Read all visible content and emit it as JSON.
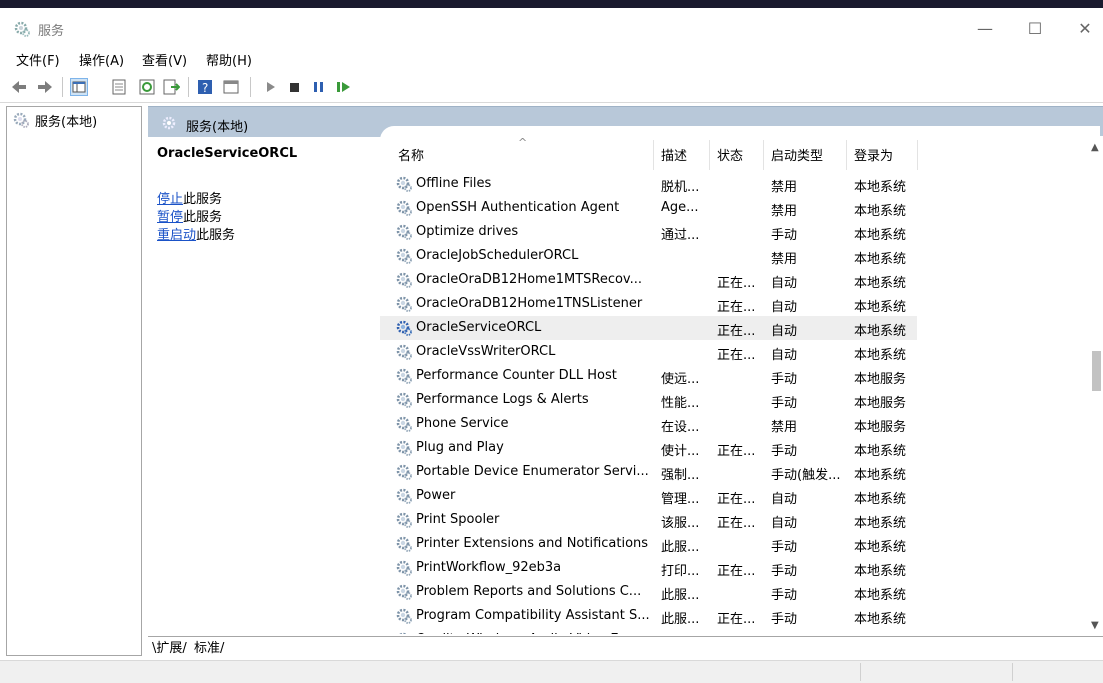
{
  "window": {
    "title": "服务",
    "minimize": "—",
    "maximize": "☐",
    "close": "✕"
  },
  "menu": [
    "文件(F)",
    "操作(A)",
    "查看(V)",
    "帮助(H)"
  ],
  "toolbar_icons": [
    "back-arrow-icon",
    "forward-arrow-icon",
    "console-tree-icon",
    "properties-icon",
    "refresh-icon",
    "export-list-icon",
    "help-icon",
    "view-icon",
    "start-service-icon",
    "stop-service-icon",
    "pause-service-icon",
    "resume-service-icon"
  ],
  "tree": {
    "root_label": "服务(本地)"
  },
  "panel": {
    "header_label": "服务(本地)",
    "selected_service": "OracleServiceORCL",
    "actions": [
      {
        "link": "停止",
        "rest": "此服务"
      },
      {
        "link": "暂停",
        "rest": "此服务"
      },
      {
        "link": "重启动",
        "rest": "此服务"
      }
    ]
  },
  "list": {
    "sort_indicator": "^",
    "columns": [
      "名称",
      "描述",
      "状态",
      "启动类型",
      "登录为"
    ],
    "rows": [
      {
        "name": "Offline Files",
        "desc": "脱机...",
        "status": "",
        "startup": "禁用",
        "logon": "本地系统"
      },
      {
        "name": "OpenSSH Authentication Agent",
        "desc": "Age...",
        "status": "",
        "startup": "禁用",
        "logon": "本地系统"
      },
      {
        "name": "Optimize drives",
        "desc": "通过...",
        "status": "",
        "startup": "手动",
        "logon": "本地系统"
      },
      {
        "name": "OracleJobSchedulerORCL",
        "desc": "",
        "status": "",
        "startup": "禁用",
        "logon": "本地系统"
      },
      {
        "name": "OracleOraDB12Home1MTSRecov...",
        "desc": "",
        "status": "正在...",
        "startup": "自动",
        "logon": "本地系统"
      },
      {
        "name": "OracleOraDB12Home1TNSListener",
        "desc": "",
        "status": "正在...",
        "startup": "自动",
        "logon": "本地系统"
      },
      {
        "name": "OracleServiceORCL",
        "desc": "",
        "status": "正在...",
        "startup": "自动",
        "logon": "本地系统",
        "selected": true
      },
      {
        "name": "OracleVssWriterORCL",
        "desc": "",
        "status": "正在...",
        "startup": "自动",
        "logon": "本地系统"
      },
      {
        "name": "Performance Counter DLL Host",
        "desc": "使远...",
        "status": "",
        "startup": "手动",
        "logon": "本地服务"
      },
      {
        "name": "Performance Logs & Alerts",
        "desc": "性能...",
        "status": "",
        "startup": "手动",
        "logon": "本地服务"
      },
      {
        "name": "Phone Service",
        "desc": "在设...",
        "status": "",
        "startup": "禁用",
        "logon": "本地服务"
      },
      {
        "name": "Plug and Play",
        "desc": "使计...",
        "status": "正在...",
        "startup": "手动",
        "logon": "本地系统"
      },
      {
        "name": "Portable Device Enumerator Servi...",
        "desc": "强制...",
        "status": "",
        "startup": "手动(触发...",
        "logon": "本地系统"
      },
      {
        "name": "Power",
        "desc": "管理...",
        "status": "正在...",
        "startup": "自动",
        "logon": "本地系统"
      },
      {
        "name": "Print Spooler",
        "desc": "该服...",
        "status": "正在...",
        "startup": "自动",
        "logon": "本地系统"
      },
      {
        "name": "Printer Extensions and Notifications",
        "desc": "此服...",
        "status": "",
        "startup": "手动",
        "logon": "本地系统"
      },
      {
        "name": "PrintWorkflow_92eb3a",
        "desc": "打印...",
        "status": "正在...",
        "startup": "手动",
        "logon": "本地系统"
      },
      {
        "name": "Problem Reports and Solutions C...",
        "desc": "此服...",
        "status": "",
        "startup": "手动",
        "logon": "本地系统"
      },
      {
        "name": "Program Compatibility Assistant S...",
        "desc": "此服...",
        "status": "正在...",
        "startup": "手动",
        "logon": "本地系统"
      },
      {
        "name": "Quality Windows Audio Video Ex...",
        "desc": "优质...",
        "status": "",
        "startup": "手动",
        "logon": "本地服务"
      }
    ]
  },
  "tabs": [
    "扩展",
    "标准"
  ],
  "colors": {
    "header_band": "#b8c8d9",
    "link": "#1a52c7",
    "selected_row": "#eeeeee"
  }
}
